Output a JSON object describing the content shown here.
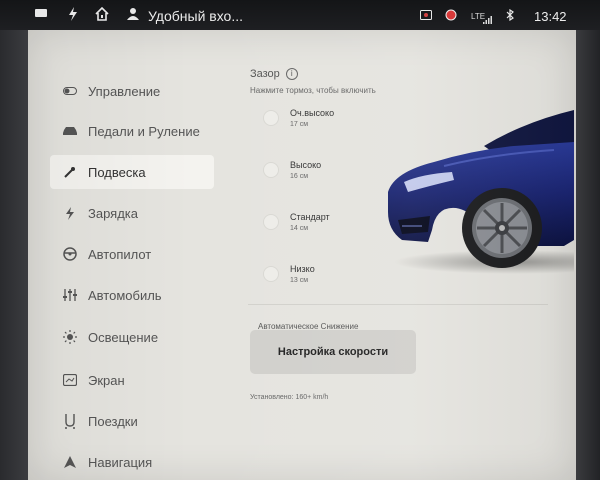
{
  "status_bar": {
    "profile_name": "Удобный вхо...",
    "network": "LTE",
    "time": "13:42",
    "icons": [
      "car-icon",
      "lightning-icon",
      "home-icon",
      "person-icon",
      "camera-icon",
      "record-icon",
      "signal-icon",
      "bluetooth-icon"
    ]
  },
  "sidebar": {
    "items": [
      {
        "label": "Управление",
        "icon": "toggle-icon",
        "active": false
      },
      {
        "label": "Педали и Руление",
        "icon": "car-icon",
        "active": false
      },
      {
        "label": "Подвеска",
        "icon": "wrench-icon",
        "active": true
      },
      {
        "label": "Зарядка",
        "icon": "lightning-icon",
        "active": false
      },
      {
        "label": "Автопилот",
        "icon": "steering-wheel-icon",
        "active": false
      },
      {
        "label": "Автомобиль",
        "icon": "sliders-icon",
        "active": false
      },
      {
        "label": "Освещение",
        "icon": "sun-icon",
        "active": false
      },
      {
        "label": "Экран",
        "icon": "display-icon",
        "active": false
      },
      {
        "label": "Поездки",
        "icon": "trips-icon",
        "active": false
      },
      {
        "label": "Навигация",
        "icon": "navigation-arrow-icon",
        "active": false
      }
    ]
  },
  "suspension": {
    "title": "Зазор",
    "info_icon": "i",
    "hint": "Нажмите тормоз, чтобы включить",
    "options": [
      {
        "label": "Оч.высоко",
        "value": "17 см"
      },
      {
        "label": "Высоко",
        "value": "16 см"
      },
      {
        "label": "Стандарт",
        "value": "14 см"
      },
      {
        "label": "Низко",
        "value": "13 см"
      }
    ],
    "auto_lowering_label": "Автоматическое Снижение",
    "speed_button": "Настройка скорости",
    "installed_text": "Установлено: 160+ km/h"
  },
  "colors": {
    "car_body": "#1f2a6e",
    "screen_bg": "#e5e4df",
    "active_item_bg": "#f4f3ef",
    "button_bg": "#d1d0cc"
  }
}
